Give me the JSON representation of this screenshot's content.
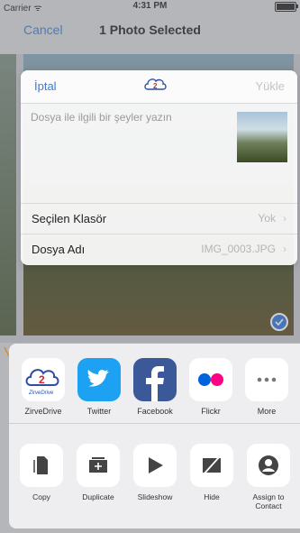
{
  "status_bar": {
    "carrier": "Carrier ᯤ",
    "time": "4:31 PM"
  },
  "nav": {
    "cancel": "Cancel",
    "title": "1 Photo Selected"
  },
  "dialog": {
    "cancel": "İptal",
    "upload": "Yükle",
    "placeholder": "Dosya ile ilgili bir şeyler yazın",
    "rows": [
      {
        "label": "Seçilen Klasör",
        "value": "Yok"
      },
      {
        "label": "Dosya Adı",
        "value": "IMG_0003.JPG"
      }
    ],
    "logo_text": "ZirveDrive"
  },
  "share_apps": [
    {
      "label": "ZirveDrive",
      "icon": "zirvedrive-icon"
    },
    {
      "label": "Twitter",
      "icon": "twitter-icon"
    },
    {
      "label": "Facebook",
      "icon": "facebook-icon"
    },
    {
      "label": "Flickr",
      "icon": "flickr-icon"
    },
    {
      "label": "More",
      "icon": "more-icon"
    }
  ],
  "actions": [
    {
      "label": "Copy",
      "icon": "copy-icon"
    },
    {
      "label": "Duplicate",
      "icon": "duplicate-icon"
    },
    {
      "label": "Slideshow",
      "icon": "play-icon"
    },
    {
      "label": "Hide",
      "icon": "hide-icon"
    },
    {
      "label": "Assign to Contact",
      "icon": "contact-icon"
    }
  ],
  "colors": {
    "accent": "#3a7bd5",
    "twitter": "#1da1f2",
    "facebook": "#3b5998",
    "flickr_blue": "#0063dc",
    "flickr_pink": "#ff0084",
    "arrow": "#e8832a"
  }
}
